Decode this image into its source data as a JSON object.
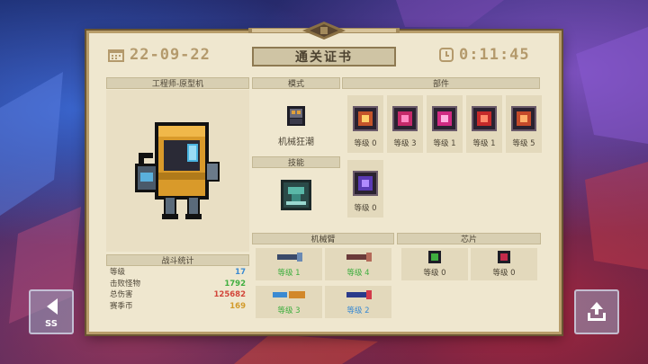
{
  "header": {
    "date": "22-09-22",
    "time": "0:11:45",
    "title": "通关证书"
  },
  "character": {
    "name": "工程师-原型机"
  },
  "sections": {
    "mode_header": "模式",
    "skill_header": "技能",
    "parts_header": "部件",
    "arm_header": "机械臂",
    "chip_header": "芯片",
    "battle_header": "战斗统计"
  },
  "mode": {
    "label": "机械狂潮",
    "icon": "robot-fist-icon"
  },
  "skill": {
    "icon": "turret-icon"
  },
  "parts": [
    {
      "level": "等级 0",
      "color": "#c4542a"
    },
    {
      "level": "等级 3",
      "color": "#c42a6a"
    },
    {
      "level": "等级 1",
      "color": "#d02a82"
    },
    {
      "level": "等级 1",
      "color": "#c42a2a"
    },
    {
      "level": "等级 5",
      "color": "#c44a2a"
    },
    {
      "level": "等级 0",
      "color": "#5a3ab4"
    }
  ],
  "arms": [
    {
      "level": "等级 1",
      "color": "#3fae3f"
    },
    {
      "level": "等级 4",
      "color": "#3fae3f"
    },
    {
      "level": "等级 3",
      "color": "#3fae3f"
    },
    {
      "level": "等级 2",
      "color": "#3a8ad2"
    }
  ],
  "chips": [
    {
      "level": "等级 0",
      "color": "#4d4536"
    },
    {
      "level": "等级 0",
      "color": "#4d4536"
    }
  ],
  "stats": [
    {
      "key": "等级",
      "value": "17",
      "color": "#3a8ad2"
    },
    {
      "key": "击败怪物",
      "value": "1792",
      "color": "#3fae3f"
    },
    {
      "key": "总伤害",
      "value": "125682",
      "color": "#d2453a"
    },
    {
      "key": "赛季币",
      "value": "169",
      "color": "#d29a2a"
    }
  ],
  "buttons": {
    "back_label": "SS"
  },
  "colors": {
    "parchment": "#efe7cf",
    "border_gold": "#b89d6a",
    "text_dark": "#4d4536"
  }
}
